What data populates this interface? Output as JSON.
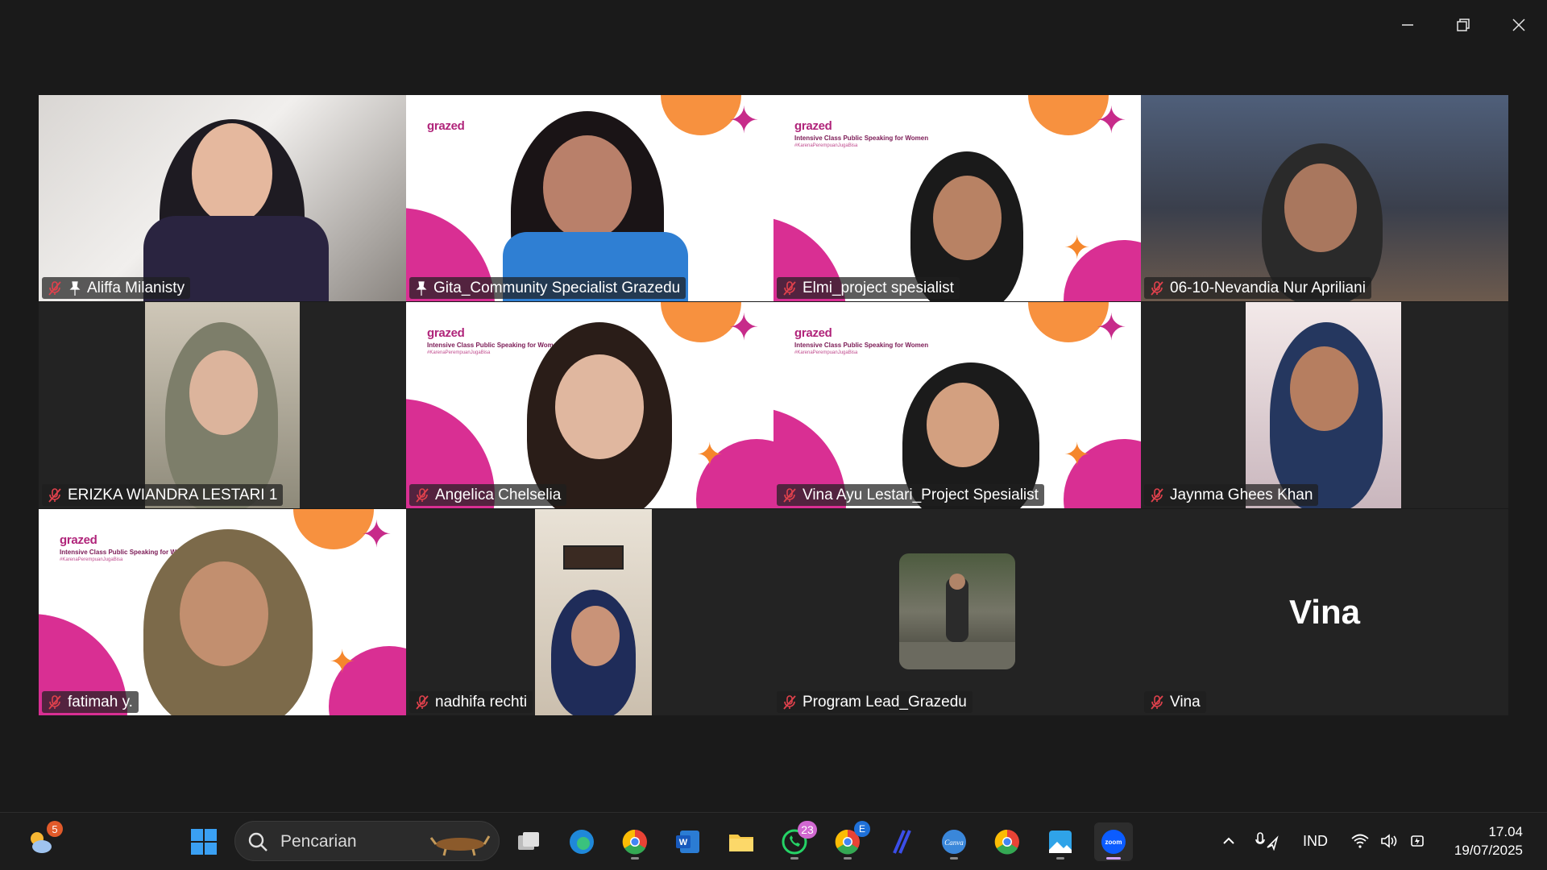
{
  "window": {
    "controls": [
      "minimize-icon",
      "restore-icon",
      "close-icon"
    ]
  },
  "participants": [
    {
      "name": "Aliffa Milanisty",
      "muted": true,
      "pinned": true
    },
    {
      "name": "Gita_Community Specialist Grazedu",
      "muted": false,
      "pinned": true,
      "active_speaker": true
    },
    {
      "name": "Elmi_project spesialist",
      "muted": true
    },
    {
      "name": "06-10-Nevandia Nur Apriliani",
      "muted": true
    },
    {
      "name": "ERIZKA WIANDRA LESTARI 1",
      "muted": true
    },
    {
      "name": "Angelica Chelselia",
      "muted": true
    },
    {
      "name": "Vina Ayu Lestari_Project Spesialist",
      "muted": true
    },
    {
      "name": "Jaynma Ghees Khan",
      "muted": true
    },
    {
      "name": "fatimah y.",
      "muted": true
    },
    {
      "name": "nadhifa rechti",
      "muted": true
    },
    {
      "name": "Program Lead_Grazedu",
      "muted": true
    },
    {
      "name": "Vina",
      "muted": true,
      "display_text": "Vina"
    }
  ],
  "background": {
    "logo": "grazed",
    "subtitle": "Intensive Class Public Speaking for Women",
    "hashtag": "#KarenaPerempuanJugaBisa"
  },
  "taskbar": {
    "weather_badge": "5",
    "search_placeholder": "Pencarian",
    "whatsapp_badge": "23",
    "chrome_badge": "E",
    "apps": [
      "windows-start",
      "search",
      "task-view",
      "edge",
      "chrome",
      "word",
      "file-explorer",
      "whatsapp",
      "chrome-profile",
      "linear",
      "canva",
      "chrome-2",
      "photos",
      "zoom"
    ],
    "language": "IND",
    "time": "17.04",
    "date": "19/07/2025"
  },
  "colors": {
    "active_outline": "#23d9a5",
    "brand_pink": "#d92f93",
    "brand_orange": "#f7913f",
    "muted_red": "#e0414c"
  }
}
